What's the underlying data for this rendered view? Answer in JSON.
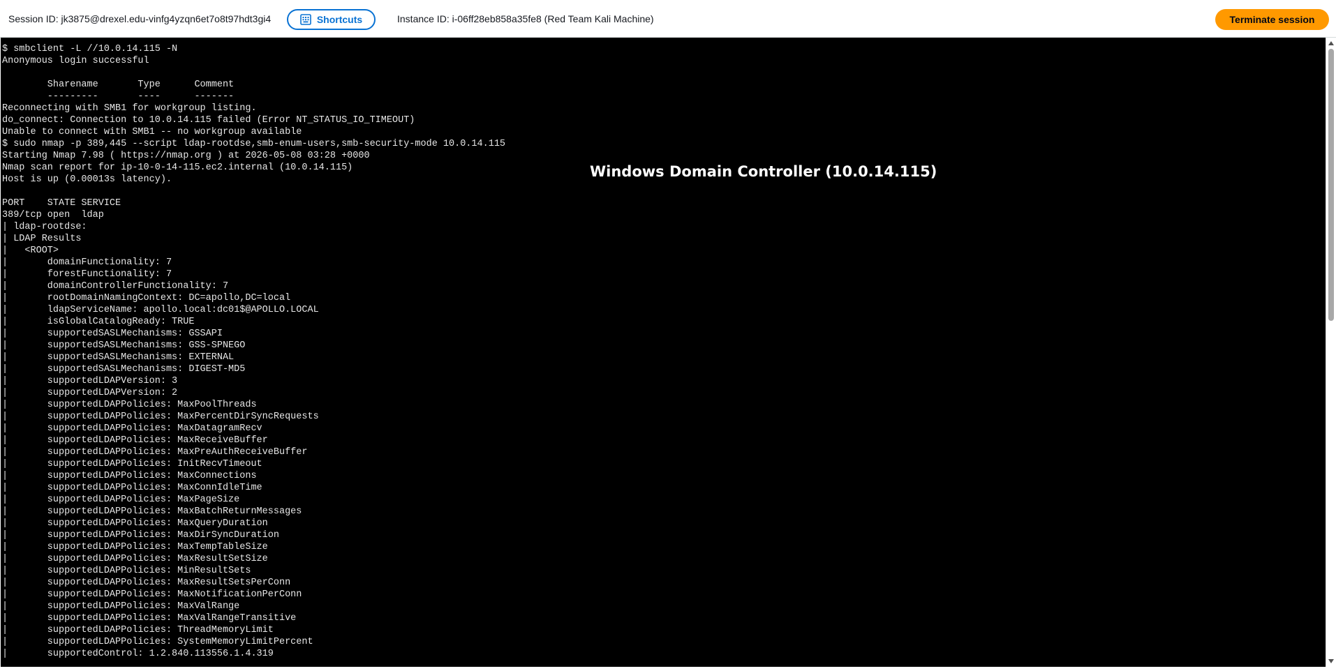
{
  "header": {
    "session_id": "Session ID: jk3875@drexel.edu-vinfg4yzqn6et7o8t97hdt3gi4",
    "shortcuts_label": "Shortcuts",
    "instance_id": "Instance ID: i-06ff28eb858a35fe8 (Red Team Kali Machine)",
    "terminate_label": "Terminate session",
    "shortcuts_icon": "keyboard-icon",
    "accent_color": "#0972d3",
    "terminate_color": "#ff9900"
  },
  "overlay": {
    "title": "Windows Domain Controller (10.0.14.115)"
  },
  "terminal": {
    "background": "#000000",
    "text_color": "#e6e6e6",
    "lines": [
      "$ smbclient -L //10.0.14.115 -N",
      "Anonymous login successful",
      "",
      "        Sharename       Type      Comment",
      "        ---------       ----      -------",
      "Reconnecting with SMB1 for workgroup listing.",
      "do_connect: Connection to 10.0.14.115 failed (Error NT_STATUS_IO_TIMEOUT)",
      "Unable to connect with SMB1 -- no workgroup available",
      "$ sudo nmap -p 389,445 --script ldap-rootdse,smb-enum-users,smb-security-mode 10.0.14.115",
      "Starting Nmap 7.98 ( https://nmap.org ) at 2026-05-08 03:28 +0000",
      "Nmap scan report for ip-10-0-14-115.ec2.internal (10.0.14.115)",
      "Host is up (0.00013s latency).",
      "",
      "PORT    STATE SERVICE",
      "389/tcp open  ldap",
      "| ldap-rootdse:",
      "| LDAP Results",
      "|   <ROOT>",
      "|       domainFunctionality: 7",
      "|       forestFunctionality: 7",
      "|       domainControllerFunctionality: 7",
      "|       rootDomainNamingContext: DC=apollo,DC=local",
      "|       ldapServiceName: apollo.local:dc01$@APOLLO.LOCAL",
      "|       isGlobalCatalogReady: TRUE",
      "|       supportedSASLMechanisms: GSSAPI",
      "|       supportedSASLMechanisms: GSS-SPNEGO",
      "|       supportedSASLMechanisms: EXTERNAL",
      "|       supportedSASLMechanisms: DIGEST-MD5",
      "|       supportedLDAPVersion: 3",
      "|       supportedLDAPVersion: 2",
      "|       supportedLDAPPolicies: MaxPoolThreads",
      "|       supportedLDAPPolicies: MaxPercentDirSyncRequests",
      "|       supportedLDAPPolicies: MaxDatagramRecv",
      "|       supportedLDAPPolicies: MaxReceiveBuffer",
      "|       supportedLDAPPolicies: MaxPreAuthReceiveBuffer",
      "|       supportedLDAPPolicies: InitRecvTimeout",
      "|       supportedLDAPPolicies: MaxConnections",
      "|       supportedLDAPPolicies: MaxConnIdleTime",
      "|       supportedLDAPPolicies: MaxPageSize",
      "|       supportedLDAPPolicies: MaxBatchReturnMessages",
      "|       supportedLDAPPolicies: MaxQueryDuration",
      "|       supportedLDAPPolicies: MaxDirSyncDuration",
      "|       supportedLDAPPolicies: MaxTempTableSize",
      "|       supportedLDAPPolicies: MaxResultSetSize",
      "|       supportedLDAPPolicies: MinResultSets",
      "|       supportedLDAPPolicies: MaxResultSetsPerConn",
      "|       supportedLDAPPolicies: MaxNotificationPerConn",
      "|       supportedLDAPPolicies: MaxValRange",
      "|       supportedLDAPPolicies: MaxValRangeTransitive",
      "|       supportedLDAPPolicies: ThreadMemoryLimit",
      "|       supportedLDAPPolicies: SystemMemoryLimitPercent",
      "|       supportedControl: 1.2.840.113556.1.4.319"
    ]
  }
}
